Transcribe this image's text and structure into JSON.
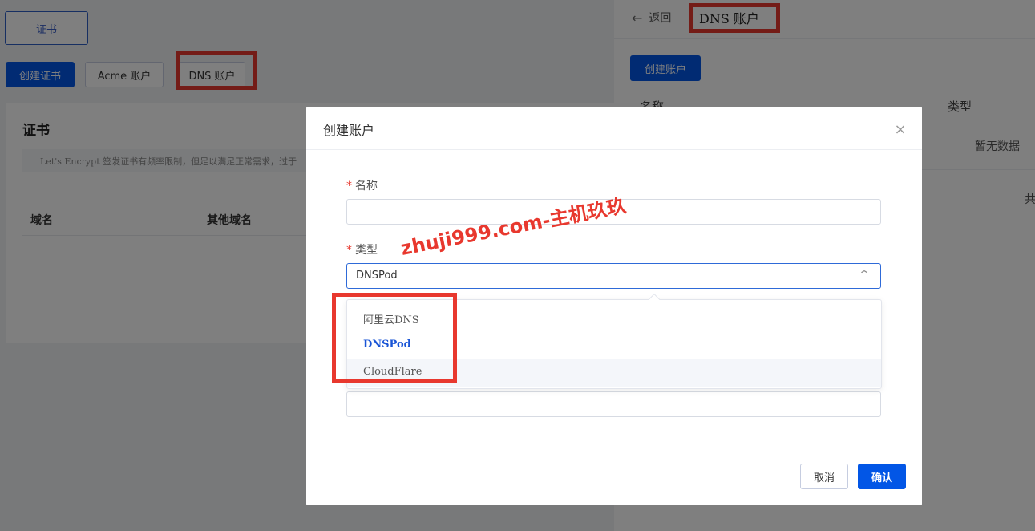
{
  "background": {
    "cert_tab": "证书",
    "create_cert_button": "创建证书",
    "acme_account_button": "Acme 账户",
    "dns_account_button": "DNS 账户",
    "card_title": "证书",
    "notice": "Let's Encrypt 签发证书有频率限制，但足以满足正常需求，过于",
    "table_headers": [
      "域名",
      "其他域名"
    ]
  },
  "drawer": {
    "back_label": "返回",
    "back_icon": "arrow-left-icon",
    "title": "DNS 账户",
    "create_account_button": "创建账户",
    "columns": [
      "名称",
      "类型"
    ],
    "empty_text": "暂无数据",
    "total_text": "共"
  },
  "modal": {
    "title": "创建账户",
    "close_icon": "close-icon",
    "name_label": "名称",
    "name_value": "",
    "type_label": "类型",
    "type_value": "DNSPod",
    "type_options": [
      "阿里云DNS",
      "DNSPod",
      "CloudFlare"
    ],
    "cancel_label": "取消",
    "confirm_label": "确认"
  },
  "watermark": "zhuji999.com-主机玖玖",
  "colors": {
    "primary": "#0256e6",
    "annotation_red": "#e8382e",
    "selected_option": "#1a55d6"
  }
}
